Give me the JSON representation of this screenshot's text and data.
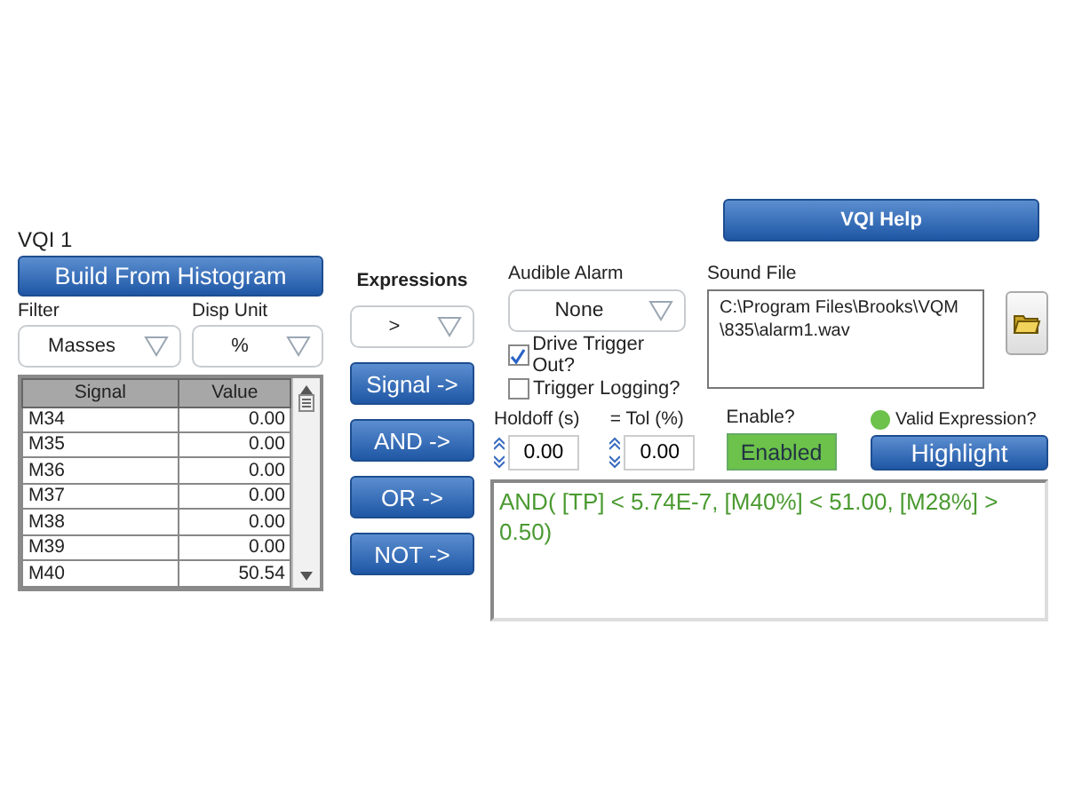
{
  "help_button": "VQI Help",
  "title": "VQI 1",
  "build_button": "Build From Histogram",
  "filter": {
    "label": "Filter",
    "value": "Masses"
  },
  "disp_unit": {
    "label": "Disp Unit",
    "value": "%"
  },
  "table": {
    "columns": [
      "Signal",
      "Value"
    ],
    "rows": [
      {
        "signal": "M34",
        "value": "0.00"
      },
      {
        "signal": "M35",
        "value": "0.00"
      },
      {
        "signal": "M36",
        "value": "0.00"
      },
      {
        "signal": "M37",
        "value": "0.00"
      },
      {
        "signal": "M38",
        "value": "0.00"
      },
      {
        "signal": "M39",
        "value": "0.00"
      },
      {
        "signal": "M40",
        "value": "50.54"
      }
    ]
  },
  "expressions": {
    "label": "Expressions",
    "operator": ">",
    "buttons": [
      "Signal ->",
      "AND ->",
      "OR ->",
      "NOT ->"
    ]
  },
  "audible_alarm": {
    "label": "Audible Alarm",
    "value": "None"
  },
  "checkboxes": [
    {
      "label": "Drive Trigger Out?",
      "checked": true
    },
    {
      "label": "Trigger Logging?",
      "checked": false
    }
  ],
  "sound_file": {
    "label": "Sound File",
    "value": "C:\\Program Files\\Brooks\\VQM\\835\\alarm1.wav"
  },
  "holdoff": {
    "label": "Holdoff (s)",
    "value": "0.00"
  },
  "tolerance": {
    "label": "= Tol (%)",
    "value": "0.00"
  },
  "enable": {
    "label": "Enable?",
    "button": "Enabled",
    "on": true
  },
  "valid_expression": {
    "label": "Valid Expression?",
    "valid": true
  },
  "highlight_button": "Highlight",
  "expression": "AND( [TP] < 5.74E-7, [M40%] < 51.00, [M28%] > 0.50)"
}
